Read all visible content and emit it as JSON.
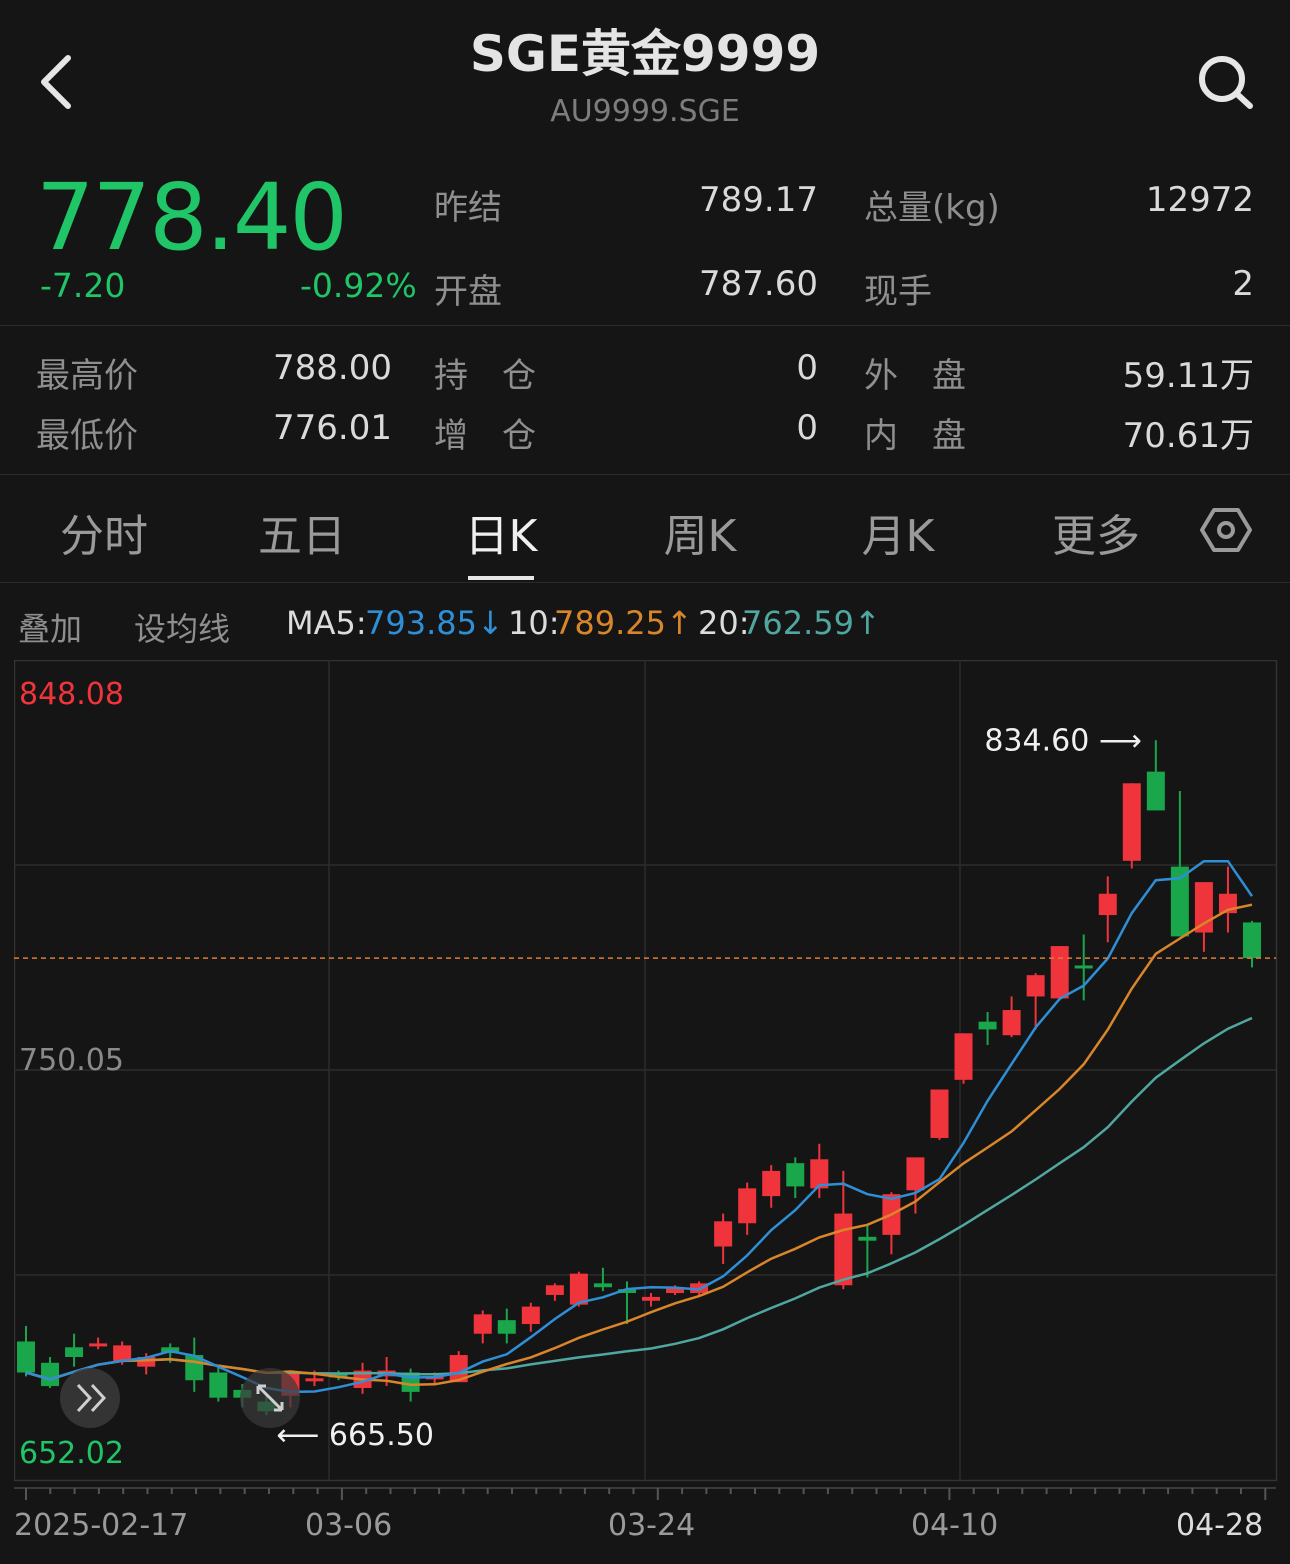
{
  "header": {
    "title": "SGE黄金9999",
    "subtitle": "AU9999.SGE"
  },
  "quote": {
    "price": "778.40",
    "change": "-7.20",
    "change_pct": "-0.92%",
    "color": "#1fc566"
  },
  "stats": {
    "prev_close_label": "昨结",
    "prev_close": "789.17",
    "volume_label": "总量(kg)",
    "volume": "12972",
    "open_label": "开盘",
    "open": "787.60",
    "last_hand_label": "现手",
    "last_hand": "2",
    "high_label": "最高价",
    "high": "788.00",
    "position_label": "持　仓",
    "position": "0",
    "outer_label": "外　盘",
    "outer": "59.11万",
    "low_label": "最低价",
    "low": "776.01",
    "increase_label": "增　仓",
    "increase": "0",
    "inner_label": "内　盘",
    "inner": "70.61万"
  },
  "tabs": [
    {
      "label": "分时"
    },
    {
      "label": "五日"
    },
    {
      "label": "日K",
      "active": true
    },
    {
      "label": "周K"
    },
    {
      "label": "月K"
    },
    {
      "label": "更多"
    }
  ],
  "controls": {
    "overlay": "叠加",
    "set_ma": "设均线"
  },
  "ma": {
    "ma5_label": "MA5:",
    "ma5_value": "793.85↓",
    "ma5_color": "#2f8fd6",
    "ma10_label": "10:",
    "ma10_value": "789.25↑",
    "ma10_color": "#d9862a",
    "ma20_label": "20:",
    "ma20_value": "762.59↑",
    "ma20_color": "#4fa7a0"
  },
  "chart_data": {
    "type": "candlestick",
    "y_top_label": "848.08",
    "y_mid_label": "750.05",
    "y_bottom_label": "652.02",
    "ylim": [
      652.02,
      848.08
    ],
    "current_price": 778.4,
    "max_annotation": "834.60 ⟶",
    "min_annotation": "⟵ 665.50",
    "x_labels": [
      "2025-02-17",
      "03-06",
      "03-24",
      "04-10",
      "04-28"
    ],
    "up_color": "#f0343b",
    "down_color": "#1aa64b",
    "candles": [
      [
        679.5,
        683.5,
        670.5,
        671.5
      ],
      [
        674.0,
        675.5,
        667.5,
        668.0
      ],
      [
        678.0,
        681.5,
        673.0,
        675.5
      ],
      [
        678.5,
        680.5,
        677.5,
        679.0
      ],
      [
        674.5,
        679.5,
        673.5,
        678.5
      ],
      [
        673.0,
        676.5,
        671.0,
        675.5
      ],
      [
        678.0,
        679.0,
        674.0,
        676.5
      ],
      [
        676.0,
        680.5,
        666.5,
        669.5
      ],
      [
        671.5,
        673.0,
        664.0,
        665.0
      ],
      [
        667.0,
        668.5,
        662.5,
        665.0
      ],
      [
        664.0,
        665.5,
        660.5,
        661.5
      ],
      [
        665.5,
        672.0,
        662.5,
        671.5
      ],
      [
        669.5,
        672.0,
        668.0,
        670.0
      ],
      [
        671.0,
        672.0,
        669.5,
        670.5
      ],
      [
        667.5,
        674.0,
        666.0,
        672.0
      ],
      [
        670.5,
        675.5,
        668.0,
        672.0
      ],
      [
        671.5,
        672.5,
        664.0,
        666.5
      ],
      [
        670.0,
        671.5,
        668.5,
        670.5
      ],
      [
        669.0,
        677.0,
        669.0,
        676.0
      ],
      [
        681.5,
        687.5,
        679.0,
        686.5
      ],
      [
        685.0,
        688.0,
        679.0,
        681.5
      ],
      [
        684.0,
        689.5,
        682.0,
        688.5
      ],
      [
        691.5,
        694.5,
        690.0,
        694.0
      ],
      [
        689.0,
        697.5,
        688.5,
        697.0
      ],
      [
        694.5,
        698.5,
        692.5,
        693.5
      ],
      [
        693.0,
        695.0,
        684.0,
        692.0
      ],
      [
        690.0,
        692.0,
        688.5,
        691.0
      ],
      [
        692.0,
        694.0,
        691.5,
        693.5
      ],
      [
        692.0,
        695.0,
        691.0,
        694.5
      ],
      [
        704.0,
        712.5,
        699.5,
        710.5
      ],
      [
        710.0,
        720.5,
        707.0,
        719.0
      ],
      [
        717.0,
        725.0,
        714.0,
        723.5
      ],
      [
        725.5,
        727.0,
        716.5,
        719.5
      ],
      [
        719.0,
        730.5,
        716.5,
        726.5
      ],
      [
        694.0,
        723.5,
        693.0,
        712.5
      ],
      [
        706.5,
        709.5,
        696.0,
        705.5
      ],
      [
        707.0,
        718.0,
        702.0,
        717.5
      ],
      [
        718.5,
        726.5,
        712.5,
        727.0
      ],
      [
        732.0,
        740.5,
        731.5,
        744.5
      ],
      [
        747.0,
        746.5,
        746.0,
        759.0
      ],
      [
        762.0,
        764.5,
        756.0,
        760.0
      ],
      [
        758.5,
        768.5,
        758.0,
        765.0
      ],
      [
        768.5,
        774.5,
        760.0,
        774.0
      ],
      [
        768.0,
        779.5,
        767.5,
        781.5
      ],
      [
        776.5,
        784.5,
        767.5,
        776.0
      ],
      [
        789.5,
        799.5,
        782.5,
        795.0
      ],
      [
        803.5,
        814.5,
        801.5,
        823.5
      ],
      [
        826.5,
        834.6,
        820.5,
        816.5
      ],
      [
        802.0,
        821.5,
        801.5,
        784.0
      ],
      [
        785.0,
        790.0,
        780.0,
        798.0
      ],
      [
        790.0,
        802.0,
        785.0,
        795.0
      ],
      [
        787.6,
        788.0,
        776.0,
        778.4
      ]
    ]
  }
}
